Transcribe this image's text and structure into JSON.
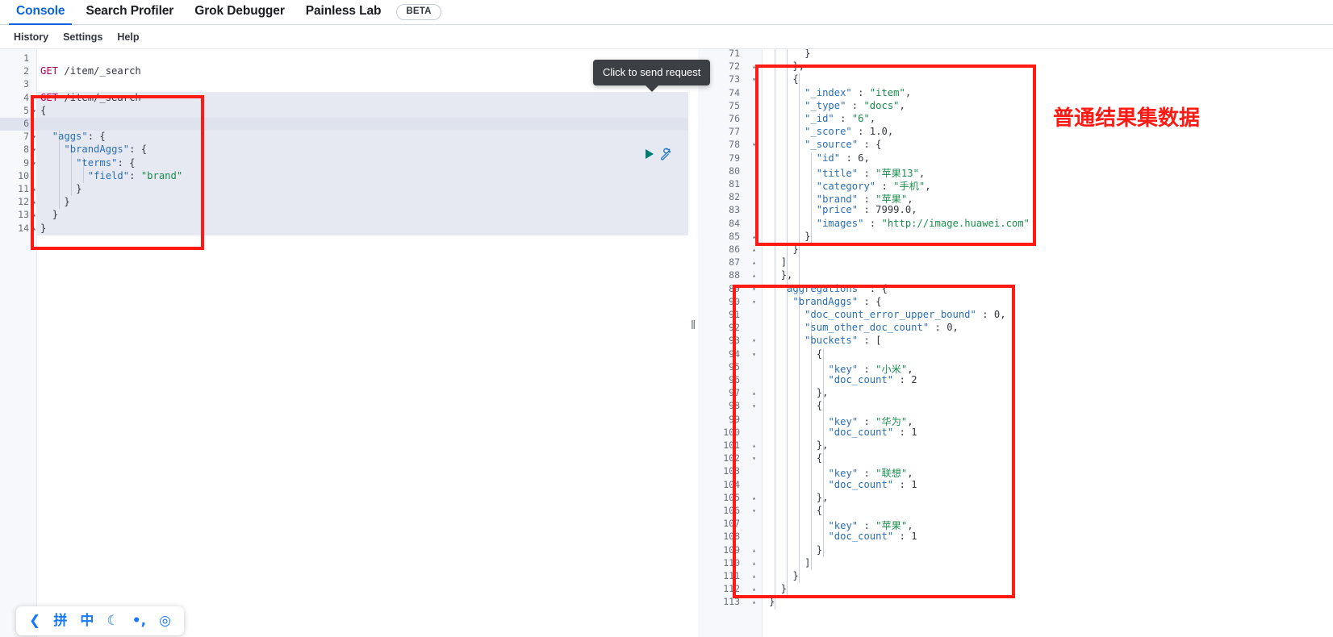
{
  "tabs": [
    {
      "label": "Console",
      "active": true
    },
    {
      "label": "Search Profiler",
      "active": false
    },
    {
      "label": "Grok Debugger",
      "active": false
    },
    {
      "label": "Painless Lab",
      "active": false
    }
  ],
  "beta_badge": "BETA",
  "menu": [
    {
      "label": "History"
    },
    {
      "label": "Settings"
    },
    {
      "label": "Help"
    }
  ],
  "tooltip": {
    "text": "Click to send request"
  },
  "icons": {
    "play": "play-icon",
    "wrench": "wrench-icon",
    "splitter": "‖"
  },
  "request_editor": {
    "lines": [
      {
        "n": 1,
        "fold": "",
        "text": ""
      },
      {
        "n": 2,
        "fold": "",
        "text": "GET /item/_search",
        "type": "request-line"
      },
      {
        "n": 3,
        "fold": "",
        "text": ""
      },
      {
        "n": 4,
        "fold": "",
        "text": "GET /item/_search",
        "type": "request-line"
      },
      {
        "n": 5,
        "fold": "▾",
        "text": "{"
      },
      {
        "n": 6,
        "fold": "",
        "text": "  ",
        "cursor": true
      },
      {
        "n": 7,
        "fold": "▾",
        "text": "  \"aggs\": {"
      },
      {
        "n": 8,
        "fold": "▾",
        "text": "    \"brandAggs\": {"
      },
      {
        "n": 9,
        "fold": "▾",
        "text": "      \"terms\": {"
      },
      {
        "n": 10,
        "fold": "",
        "text": "        \"field\": \"brand\""
      },
      {
        "n": 11,
        "fold": "▴",
        "text": "      }"
      },
      {
        "n": 12,
        "fold": "▴",
        "text": "    }"
      },
      {
        "n": 13,
        "fold": "▴",
        "text": "  }"
      },
      {
        "n": 14,
        "fold": "▴",
        "text": "}"
      }
    ]
  },
  "response_editor": {
    "lines": [
      {
        "n": 71,
        "fold": "",
        "text": "      }"
      },
      {
        "n": 72,
        "fold": "▴",
        "text": "    },"
      },
      {
        "n": 73,
        "fold": "▾",
        "text": "    {"
      },
      {
        "n": 74,
        "fold": "",
        "text": "      \"_index\" : \"item\","
      },
      {
        "n": 75,
        "fold": "",
        "text": "      \"_type\" : \"docs\","
      },
      {
        "n": 76,
        "fold": "",
        "text": "      \"_id\" : \"6\","
      },
      {
        "n": 77,
        "fold": "",
        "text": "      \"_score\" : 1.0,"
      },
      {
        "n": 78,
        "fold": "▾",
        "text": "      \"_source\" : {"
      },
      {
        "n": 79,
        "fold": "",
        "text": "        \"id\" : 6,"
      },
      {
        "n": 80,
        "fold": "",
        "text": "        \"title\" : \"苹果13\","
      },
      {
        "n": 81,
        "fold": "",
        "text": "        \"category\" : \"手机\","
      },
      {
        "n": 82,
        "fold": "",
        "text": "        \"brand\" : \"苹果\","
      },
      {
        "n": 83,
        "fold": "",
        "text": "        \"price\" : 7999.0,"
      },
      {
        "n": 84,
        "fold": "",
        "text": "        \"images\" : \"http://image.huawei.com\""
      },
      {
        "n": 85,
        "fold": "▴",
        "text": "      }"
      },
      {
        "n": 86,
        "fold": "▴",
        "text": "    }"
      },
      {
        "n": 87,
        "fold": "▴",
        "text": "  ]"
      },
      {
        "n": 88,
        "fold": "▴",
        "text": "  },"
      },
      {
        "n": 89,
        "fold": "▾",
        "text": "  \"aggregations\" : {"
      },
      {
        "n": 90,
        "fold": "▾",
        "text": "    \"brandAggs\" : {"
      },
      {
        "n": 91,
        "fold": "",
        "text": "      \"doc_count_error_upper_bound\" : 0,"
      },
      {
        "n": 92,
        "fold": "",
        "text": "      \"sum_other_doc_count\" : 0,"
      },
      {
        "n": 93,
        "fold": "▾",
        "text": "      \"buckets\" : ["
      },
      {
        "n": 94,
        "fold": "▾",
        "text": "        {"
      },
      {
        "n": 95,
        "fold": "",
        "text": "          \"key\" : \"小米\","
      },
      {
        "n": 96,
        "fold": "",
        "text": "          \"doc_count\" : 2"
      },
      {
        "n": 97,
        "fold": "▴",
        "text": "        },"
      },
      {
        "n": 98,
        "fold": "▾",
        "text": "        {"
      },
      {
        "n": 99,
        "fold": "",
        "text": "          \"key\" : \"华为\","
      },
      {
        "n": 100,
        "fold": "",
        "text": "          \"doc_count\" : 1"
      },
      {
        "n": 101,
        "fold": "▴",
        "text": "        },"
      },
      {
        "n": 102,
        "fold": "▾",
        "text": "        {"
      },
      {
        "n": 103,
        "fold": "",
        "text": "          \"key\" : \"联想\","
      },
      {
        "n": 104,
        "fold": "",
        "text": "          \"doc_count\" : 1"
      },
      {
        "n": 105,
        "fold": "▴",
        "text": "        },"
      },
      {
        "n": 106,
        "fold": "▾",
        "text": "        {"
      },
      {
        "n": 107,
        "fold": "",
        "text": "          \"key\" : \"苹果\","
      },
      {
        "n": 108,
        "fold": "",
        "text": "          \"doc_count\" : 1"
      },
      {
        "n": 109,
        "fold": "▴",
        "text": "        }"
      },
      {
        "n": 110,
        "fold": "▴",
        "text": "      ]"
      },
      {
        "n": 111,
        "fold": "▴",
        "text": "    }"
      },
      {
        "n": 112,
        "fold": "▴",
        "text": "  }"
      },
      {
        "n": 113,
        "fold": "▴",
        "text": "}"
      }
    ]
  },
  "annotations": {
    "color": "#ff1a13",
    "label_results": "普通结果集数据"
  },
  "ime": {
    "items": [
      {
        "name": "sogou-logo-icon",
        "glyph": "❮"
      },
      {
        "name": "pinyin-mode-icon",
        "glyph": "拼"
      },
      {
        "name": "chinese-mode-icon",
        "glyph": "中"
      },
      {
        "name": "moon-icon",
        "glyph": "☾"
      },
      {
        "name": "punctuation-icon",
        "glyph": "•,"
      },
      {
        "name": "target-icon",
        "glyph": "◎"
      }
    ]
  }
}
